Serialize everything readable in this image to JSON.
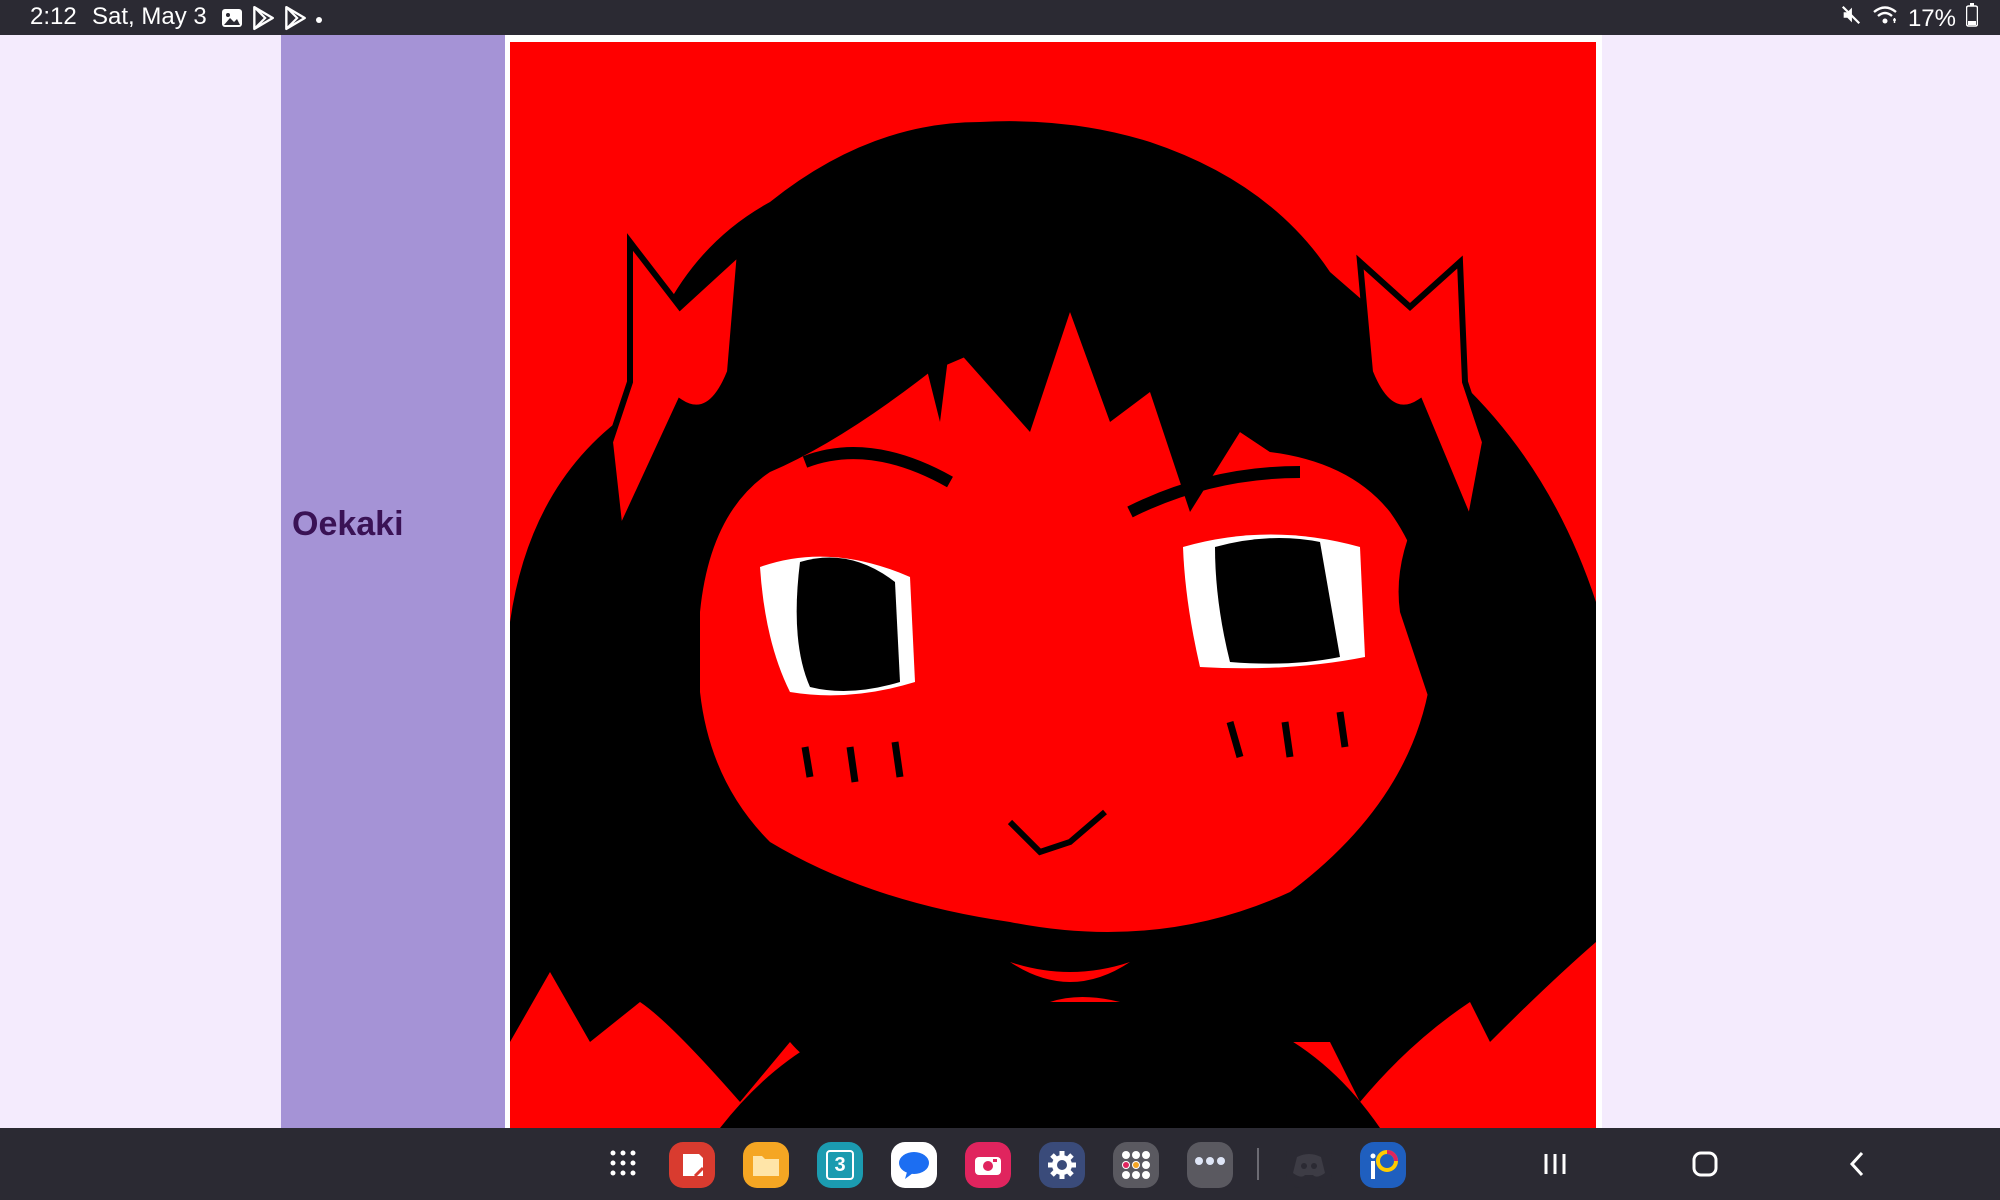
{
  "status_bar": {
    "time": "2:12",
    "date": "Sat, May 3",
    "notification_icons": [
      "gallery-icon",
      "play-store-icon",
      "play-store-icon",
      "dot-icon"
    ],
    "system_icons": [
      "mute-icon",
      "wifi-icon",
      "battery-icon"
    ],
    "battery": "17%"
  },
  "page": {
    "sidebar_title": "Oekaki",
    "colors": {
      "background": "#f4ebfd",
      "sidebar": "#a593d6",
      "title": "#3a1255",
      "canvas_red": "#ff0000"
    }
  },
  "drawing": {
    "subject": "red-and-black oekaki drawing of a girl with dark bob hair and red bows"
  },
  "taskbar": {
    "apps": [
      "app-drawer-icon",
      "notes-app-icon",
      "files-app-icon",
      "calendar-app-icon",
      "messages-app-icon",
      "camera-app-icon",
      "settings-app-icon",
      "app-folder-icon",
      "game-folder-icon",
      "discord-app-icon",
      "ibispaint-app-icon"
    ],
    "calendar_day": "3",
    "nav": [
      "recents-button",
      "home-button",
      "back-button"
    ]
  }
}
